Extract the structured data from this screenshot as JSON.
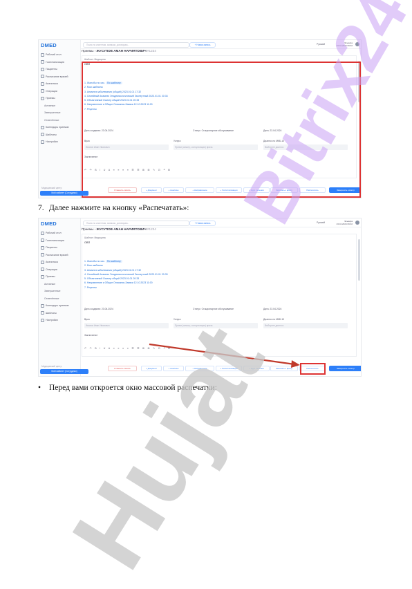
{
  "app": {
    "logo": "DMED",
    "search_placeholder": "Поиск по клиентам, заявкам, договорам...",
    "new_record": "+ Новая запись",
    "lang": "Русский",
    "user_name": "Эльвира",
    "user_date": "23.04.2024 09:02",
    "sidebar": [
      {
        "label": "Рабочий стол"
      },
      {
        "label": "Госпитализация"
      },
      {
        "label": "Пациенты"
      },
      {
        "label": "Расписание врачей"
      },
      {
        "label": "Аналитика"
      },
      {
        "label": "Операции"
      },
      {
        "label": "Приемы"
      },
      {
        "label": "Активные",
        "sub": true
      },
      {
        "label": "Завершенные",
        "sub": true
      },
      {
        "label": "Отменённые",
        "sub": true
      },
      {
        "label": "Календарь приемов"
      },
      {
        "label": "Шаблоны"
      },
      {
        "label": "Настройки"
      }
    ],
    "bottom_label": "Медицинский центр",
    "bottom_button": "Мой кабинет (Сотрудник)",
    "breadcrumb_root": "Приемы",
    "breadcrumb_patient": "ЖУСУПОВ АМАН НАРИЯТОВИЧ",
    "breadcrumb_id": "#1234",
    "template_label": "Шаблон: Медицина",
    "template_value": "ОВП",
    "templates": [
      "1. Жалобы по сис.",
      "2. Мои шаблоны",
      "3. Анамнез заболевания (общий) 2023.01.01 17:32",
      "4. Семейный Анамнез Эпидемиологический Экспертный 2023.01.01 20:33",
      "5. Объективный Осмотр общий 2023.01.01 20:33",
      "6. Направление и Общие Описания-Заявки 12.10.2023 11:00",
      "7. Рецепты"
    ],
    "template_tag": "По шаблону",
    "date_create": "Дата создания: 23.04.2024",
    "status": "Статус: Стационарное обслуживание",
    "visit_date": "Дата: 23.04.2024",
    "doctor_label": "Врач",
    "doctor_value": "Иванов Иван Иванович",
    "service_label": "Услуга",
    "service_value": "Прием (осмотр, консультация) врача",
    "diag_label": "Диагноз по МКБ-10",
    "diag_placeholder": "Выберите диагноз",
    "note_label": "Заключение",
    "editor_tools": "↶ ↷ B I U A ≡ ≡ ≡ ≡ ☰ ☰ ⊞ ⊞ ✎ ⊡ ❝ ⊞",
    "actions": [
      {
        "label": "Отменить запись",
        "kind": "red"
      },
      {
        "label": "+ Документ",
        "kind": "plain"
      },
      {
        "label": "+ Анализы",
        "kind": "plain"
      },
      {
        "label": "+ Направление",
        "kind": "plain"
      },
      {
        "label": "+ Госпитализация",
        "kind": "plain"
      },
      {
        "label": "+ Курс лечения",
        "kind": "plain"
      },
      {
        "label": "Записать к врачу",
        "kind": "plain"
      },
      {
        "label": "Распечатать",
        "kind": "plain"
      },
      {
        "label": "Завершить осмотр",
        "kind": "fill"
      }
    ],
    "highlight_color": "#d33333"
  },
  "doc": {
    "step7_num": "7.",
    "step7_text": "Далее нажмите на кнопку «Распечатать»:",
    "bullet": "•",
    "bullet_text": "Перед вами откроется окно массовой распечатки:"
  },
  "watermark": {
    "text1": "Bitrix24",
    "text2": "Hujat",
    "color1": "#c9a2f5",
    "color2": "#c8c8c8"
  }
}
